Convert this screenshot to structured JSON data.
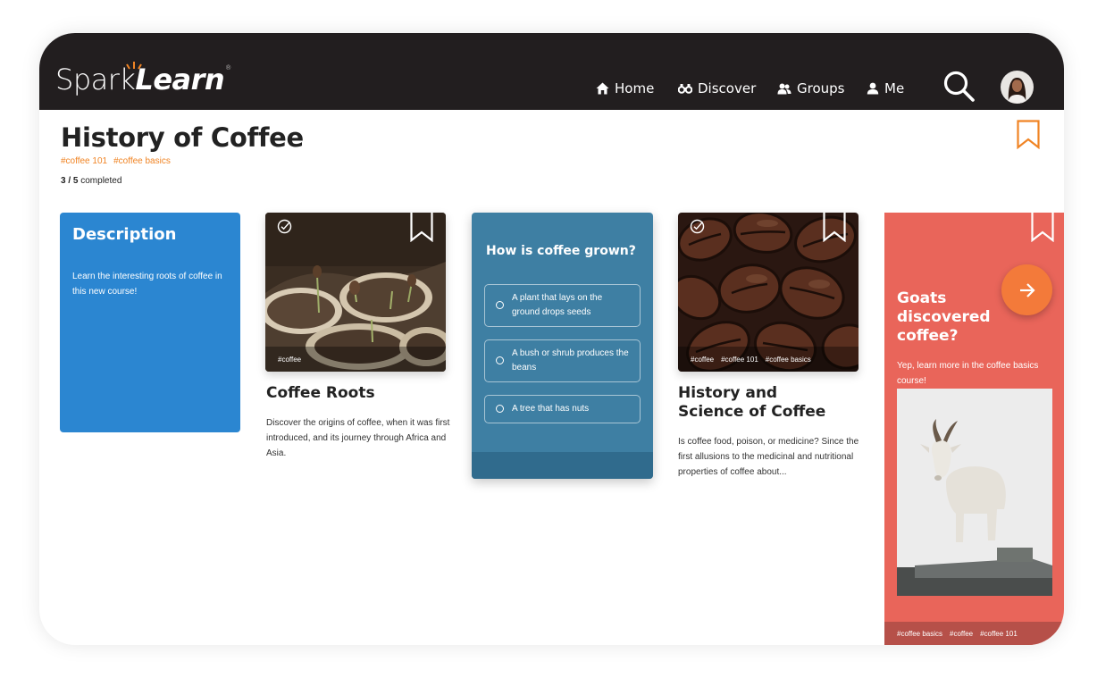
{
  "brand": {
    "name_a": "Spark",
    "name_b": "Learn",
    "reg": "®",
    "accent": "#f08424",
    "nav_bg": "#221e1f"
  },
  "nav": {
    "items": [
      {
        "label": "Home",
        "icon": "home-icon"
      },
      {
        "label": "Discover",
        "icon": "binoculars-icon"
      },
      {
        "label": "Groups",
        "icon": "group-icon"
      },
      {
        "label": "Me",
        "icon": "person-icon"
      }
    ],
    "search_icon": "search-icon",
    "avatar": "avatar"
  },
  "course": {
    "title": "History of Coffee",
    "tags": [
      "#coffee 101",
      "#coffee basics"
    ],
    "completed": "3",
    "total": "5",
    "completed_label": "completed",
    "progress_separator": "/"
  },
  "cards": {
    "description": {
      "title": "Description",
      "text": "Learn the interesting roots of coffee in this new course!",
      "color": "#2b86d1"
    },
    "roots": {
      "tags": [
        "#coffee"
      ],
      "title": "Coffee Roots",
      "text": "Discover the origins of coffee, when it was first introduced, and its journey through Africa and Asia."
    },
    "quiz": {
      "question": "How is coffee grown?",
      "options": [
        "A plant that lays on the ground drops seeds",
        "A bush or shrub produces the beans",
        "A tree that has nuts"
      ],
      "color": "#3e7fa3"
    },
    "science": {
      "tags": [
        "#coffee",
        "#coffee 101",
        "#coffee basics"
      ],
      "title_line1": "History and",
      "title_line2": "Science of Coffee",
      "text": "Is coffee food, poison, or medicine? Since the first allusions to the medicinal and nutritional properties of coffee about..."
    },
    "promo": {
      "title": "Goats discovered coffee?",
      "text": "Yep, learn more in the coffee basics course!",
      "tags": [
        "#coffee basics",
        "#coffee",
        "#coffee 101"
      ],
      "color": "#e9655a"
    }
  }
}
